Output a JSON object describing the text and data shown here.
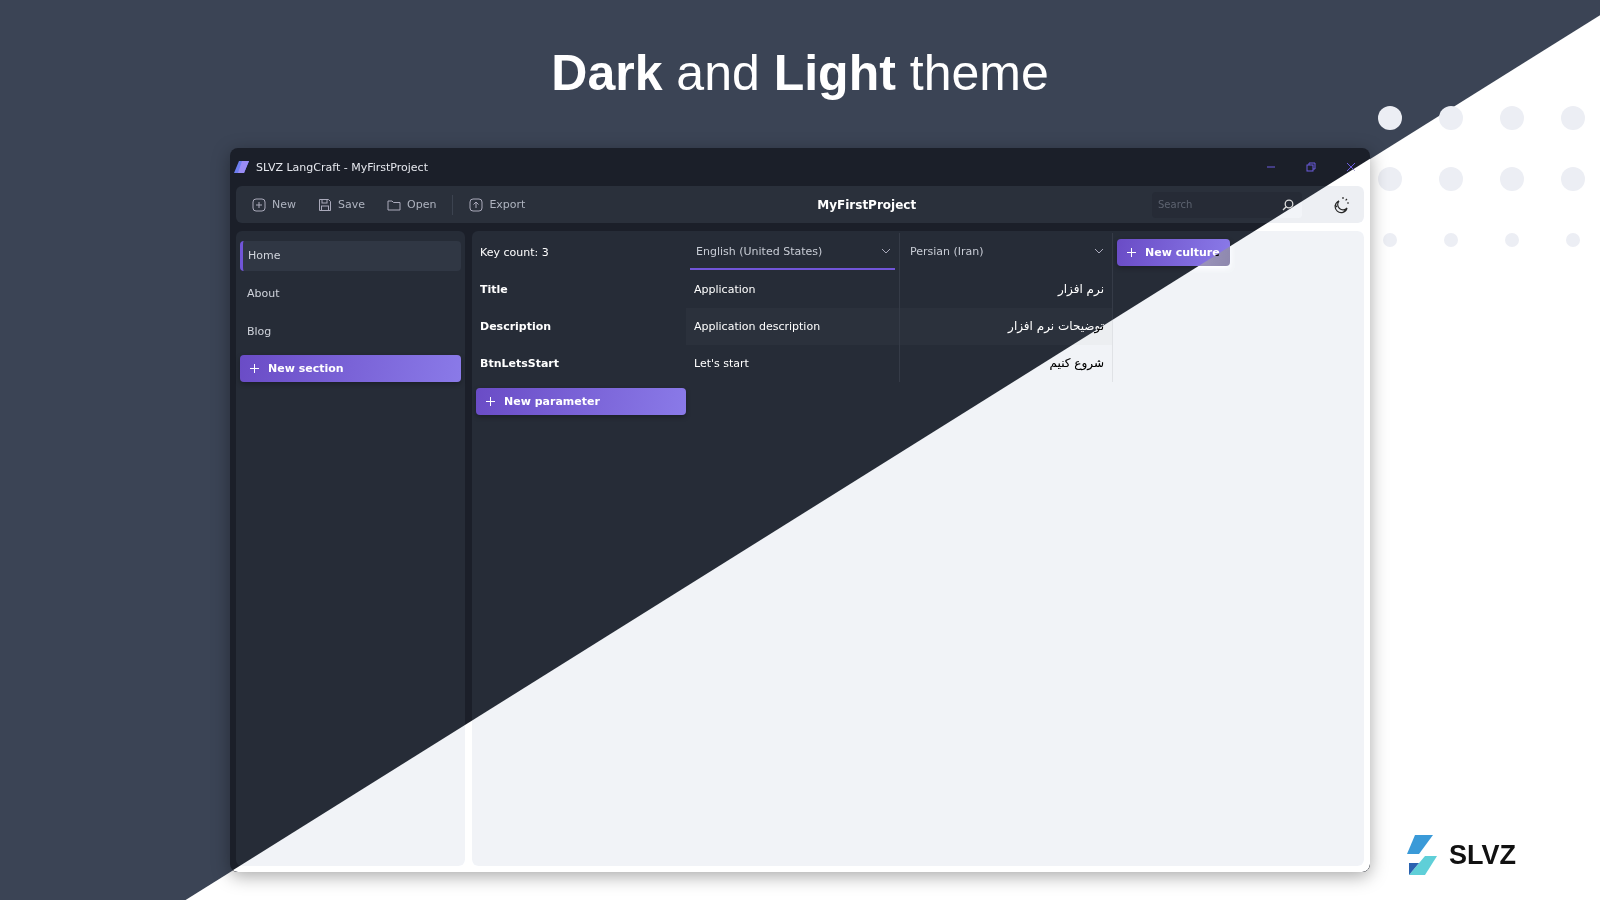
{
  "banner": {
    "title": "**Dark** and **Light** theme"
  },
  "window": {
    "title": "SLVZ LangCraft - MyFirstProject"
  },
  "toolbar": {
    "buttons": [
      {
        "label": "New",
        "kind": "new"
      },
      {
        "label": "Save",
        "kind": "save"
      },
      {
        "label": "Open",
        "kind": "open"
      },
      {
        "label": "Export",
        "kind": "export"
      }
    ],
    "project_name": "MyFirstProject",
    "search": {
      "placeholder": "Search"
    }
  },
  "sidebar": {
    "items": [
      {
        "label": "Home",
        "selected": true
      },
      {
        "label": "About",
        "selected": false
      },
      {
        "label": "Blog",
        "selected": false
      }
    ],
    "add_button": "New section"
  },
  "table": {
    "key_count": "Key count: 3",
    "cultures": [
      {
        "name": "English (United States)",
        "focused": true
      },
      {
        "name": "Persian (Iran)",
        "focused": false
      }
    ],
    "new_culture": "New culture",
    "rows": [
      {
        "key": "Title",
        "values": [
          "Application",
          "نرم افزار"
        ]
      },
      {
        "key": "Description",
        "values": [
          "Application description",
          "توضیحات نرم افزار"
        ]
      },
      {
        "key": "BtnLetsStart",
        "values": [
          "Let's start",
          "شروع کنیم"
        ]
      }
    ],
    "new_parameter": "New parameter"
  },
  "brand": {
    "name": "SLVZ"
  }
}
